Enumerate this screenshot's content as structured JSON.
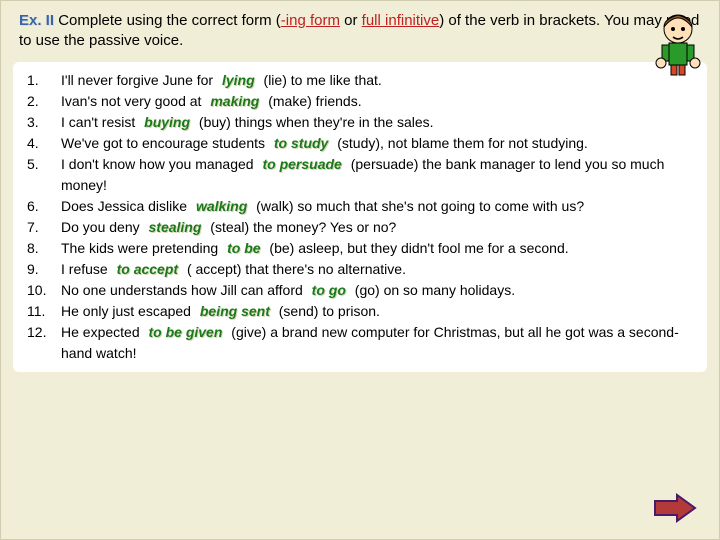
{
  "instruction": {
    "ex_label": "Ex. II",
    "text1": "  Complete using the correct form (",
    "hl1": "-ing form",
    "text2": " or ",
    "hl2": "full infinitive",
    "text3": ") of the verb in brackets. You may need to use the passive voice."
  },
  "cartoon_name": "cartoon-boy-icon",
  "arrow_name": "next-arrow-icon",
  "items": [
    {
      "n": "1.",
      "pre": "I'll never forgive June for ",
      "ans": "lying",
      "post": " (lie) to me like that."
    },
    {
      "n": "2.",
      "pre": "Ivan's not very good at ",
      "ans": "making",
      "post": " (make) friends."
    },
    {
      "n": "3.",
      "pre": "I can't resist ",
      "ans": "buying",
      "post": " (buy) things when they're in the sales."
    },
    {
      "n": "4.",
      "pre": "We've got to encourage students ",
      "ans": "to study",
      "post": " (study), not blame them for not studying."
    },
    {
      "n": "5.",
      "pre": "I don't know how you managed ",
      "ans": "to persuade",
      "post": " (persuade) the bank manager to lend you so much money!"
    },
    {
      "n": "6.",
      "pre": "Does Jessica dislike ",
      "ans": "walking",
      "post": " (walk) so much that she's not going to come with us?"
    },
    {
      "n": "7.",
      "pre": "Do you deny ",
      "ans": "stealing",
      "post": " (steal) the money? Yes or no?"
    },
    {
      "n": "8.",
      "pre": "The kids were  pretending ",
      "ans": "to be",
      "post": " (be) asleep, but they didn't fool me for a second."
    },
    {
      "n": "9.",
      "pre": "I refuse ",
      "ans": "to accept",
      "post": " ( accept) that there's no alternative."
    },
    {
      "n": "10.",
      "pre": "No one understands how Jill can afford ",
      "ans": "to go",
      "post": " (go) on so many holidays."
    },
    {
      "n": "11.",
      "pre": "He only just escaped ",
      "ans": "being sent",
      "post": " (send) to prison."
    },
    {
      "n": "12.",
      "pre": "He expected ",
      "ans": "to be given",
      "post": " (give) a brand new computer for Christmas, but all he got was a second-hand watch!"
    }
  ]
}
